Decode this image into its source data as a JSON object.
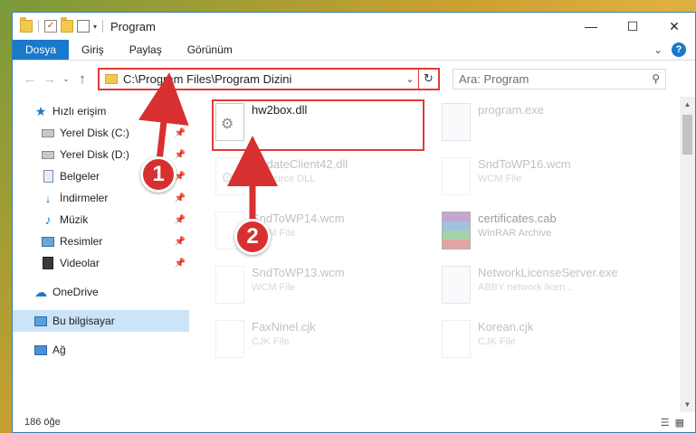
{
  "window": {
    "title": "Program",
    "controls": {
      "minimize": "—",
      "maximize": "☐",
      "close": "✕"
    }
  },
  "ribbon": {
    "tabs": [
      "Dosya",
      "Giriş",
      "Paylaş",
      "Görünüm"
    ],
    "expand_glyph": "⌄",
    "help_glyph": "?"
  },
  "address": {
    "path": "C:\\Program Files\\Program Dizini",
    "back_glyph": "←",
    "forward_glyph": "→",
    "recent_glyph": "⌄",
    "up_glyph": "↑",
    "dropdown_glyph": "⌄",
    "refresh_glyph": "↻"
  },
  "search": {
    "placeholder": "Ara: Program",
    "icon": "search-icon",
    "glyph": "⚲"
  },
  "sidebar": {
    "quick_access": {
      "label": "Hızlı erişim",
      "icon": "star-icon"
    },
    "pinned": [
      {
        "label": "Yerel Disk (C:)",
        "icon": "drive-icon"
      },
      {
        "label": "Yerel Disk (D:)",
        "icon": "drive-icon"
      },
      {
        "label": "Belgeler",
        "icon": "documents-icon"
      },
      {
        "label": "İndirmeler",
        "icon": "downloads-icon"
      },
      {
        "label": "Müzik",
        "icon": "music-icon"
      },
      {
        "label": "Resimler",
        "icon": "pictures-icon"
      },
      {
        "label": "Videolar",
        "icon": "videos-icon"
      }
    ],
    "pin_glyph": "📌",
    "onedrive": {
      "label": "OneDrive",
      "icon": "cloud-icon"
    },
    "this_pc": {
      "label": "Bu bilgisayar",
      "icon": "computer-icon"
    },
    "network": {
      "label": "Ağ",
      "icon": "network-icon"
    }
  },
  "files": {
    "highlighted": {
      "name": "hw2box.dll",
      "type": ""
    },
    "right_top": {
      "name": "program.exe",
      "type": ""
    },
    "items": [
      {
        "name": "UpdateClient42.dll",
        "type": "Resource DLL"
      },
      {
        "name": "SndToWP16.wcm",
        "type": "WCM File"
      },
      {
        "name": "SndToWP14.wcm",
        "type": "WCM File"
      },
      {
        "name": "certificates.cab",
        "type": "WinRAR Archive"
      },
      {
        "name": "SndToWP13.wcm",
        "type": "WCM File"
      },
      {
        "name": "NetworkLicenseServer.exe",
        "type": "ABBY network licen..."
      },
      {
        "name": "FaxNinel.cjk",
        "type": "CJK File"
      },
      {
        "name": "Korean.cjk",
        "type": "CJK File"
      }
    ]
  },
  "status": {
    "count": "186 öğe"
  },
  "callouts": {
    "one": "1",
    "two": "2"
  },
  "colors": {
    "accent": "#1979ca",
    "highlight": "#e03a3a",
    "selection": "#cce4f7"
  }
}
